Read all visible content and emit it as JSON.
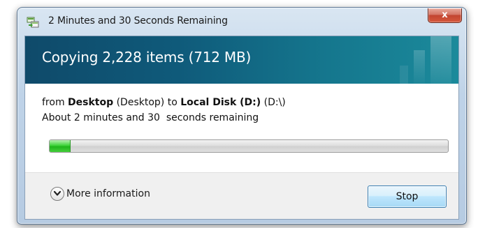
{
  "window": {
    "title": "2 Minutes and 30 Seconds Remaining",
    "close_label": "x",
    "close_icon": "close-x-icon",
    "title_icon": "copy-files-icon"
  },
  "banner": {
    "title": "Copying 2,228 items (712 MB)"
  },
  "details": {
    "from_prefix": "from",
    "source_name": "Desktop",
    "source_path": "(Desktop)",
    "to_word": "to",
    "dest_name": "Local Disk (D:)",
    "dest_path": "(D:\\)",
    "time_remaining": "About 2 minutes and 30  seconds remaining"
  },
  "progress": {
    "percent": 5,
    "bar_color": "#34c72c"
  },
  "footer": {
    "more_info_label": "More information",
    "more_info_icon": "chevron-down-circle-icon",
    "stop_label": "Stop"
  },
  "colors": {
    "banner": "#0f5a7a",
    "close_button": "#c7432e",
    "stop_button_border": "#3c7fb1"
  }
}
